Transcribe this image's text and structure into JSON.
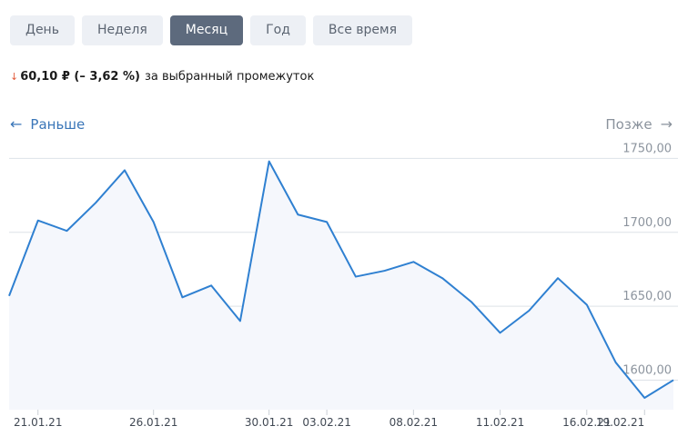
{
  "tabs": {
    "day": "День",
    "week": "Неделя",
    "month": "Месяц",
    "year": "Год",
    "all": "Все время"
  },
  "active_tab": "month",
  "change": {
    "arrow": "↓",
    "value": "60,10 ₽ (– 3,62 %)",
    "text": "за выбранный промежуток"
  },
  "nav": {
    "earlier": "Раньше",
    "later": "Позже",
    "earlier_icon": "arrow-left-icon",
    "later_icon": "arrow-right-icon"
  },
  "colors": {
    "line": "#2f80d1",
    "fill": "#f5f7fc",
    "grid": "#dde2e8",
    "down": "#e25b3c",
    "active_tab": "#5d6a7d"
  },
  "chart_data": {
    "type": "area",
    "ylim": [
      1580,
      1765
    ],
    "yticks": [
      1600,
      1650,
      1700,
      1750
    ],
    "ytick_labels": [
      "1600,00",
      "1650,00",
      "1700,00",
      "1750,00"
    ],
    "xtick_labels": [
      "21.01.21",
      "26.01.21",
      "30.01.21",
      "03.02.21",
      "08.02.21",
      "11.02.21",
      "16.02.21",
      "19.02.21"
    ],
    "xtick_index": [
      1,
      5,
      9,
      11,
      14,
      17,
      20,
      22
    ],
    "values": [
      1657,
      1708,
      1701,
      1720,
      1742,
      1707,
      1656,
      1664,
      1640,
      1748,
      1712,
      1707,
      1670,
      1674,
      1680,
      1669,
      1653,
      1632,
      1647,
      1669,
      1651,
      1612,
      1588,
      1600
    ],
    "grid": true
  }
}
